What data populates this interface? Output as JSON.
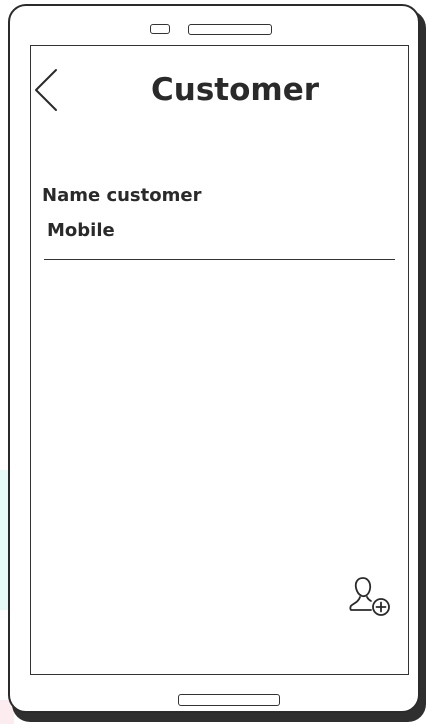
{
  "header": {
    "title": "Customer",
    "back_icon": "chevron-left-icon"
  },
  "customer": {
    "name_label": "Name customer",
    "mobile_label": "Mobile"
  },
  "actions": {
    "add_user_icon": "add-user-icon"
  }
}
